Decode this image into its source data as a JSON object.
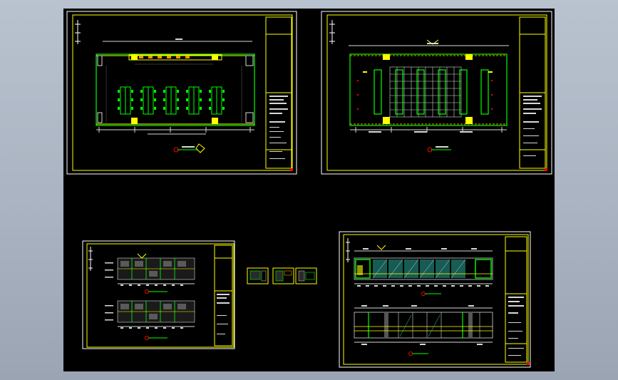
{
  "viewport": {
    "background": "#000000",
    "page_background": "#aab3c1"
  },
  "colors": {
    "frame_white": "#ffffff",
    "frame_yellow": "#ffff00",
    "wall_green": "#00ff00",
    "dim_white": "#d8d8d8",
    "accent_red": "#ff0000",
    "accent_orange": "#ff9900",
    "glass_teal": "#2aa89a"
  },
  "sheets": [
    {
      "id": "sheet-1",
      "kind": "floor-plan-furniture"
    },
    {
      "id": "sheet-2",
      "kind": "ceiling-plan-grid"
    },
    {
      "id": "sheet-3",
      "kind": "elevations-pair"
    },
    {
      "id": "sheet-4",
      "kind": "detail-thumbnails"
    },
    {
      "id": "sheet-5",
      "kind": "elevations-sections"
    }
  ]
}
